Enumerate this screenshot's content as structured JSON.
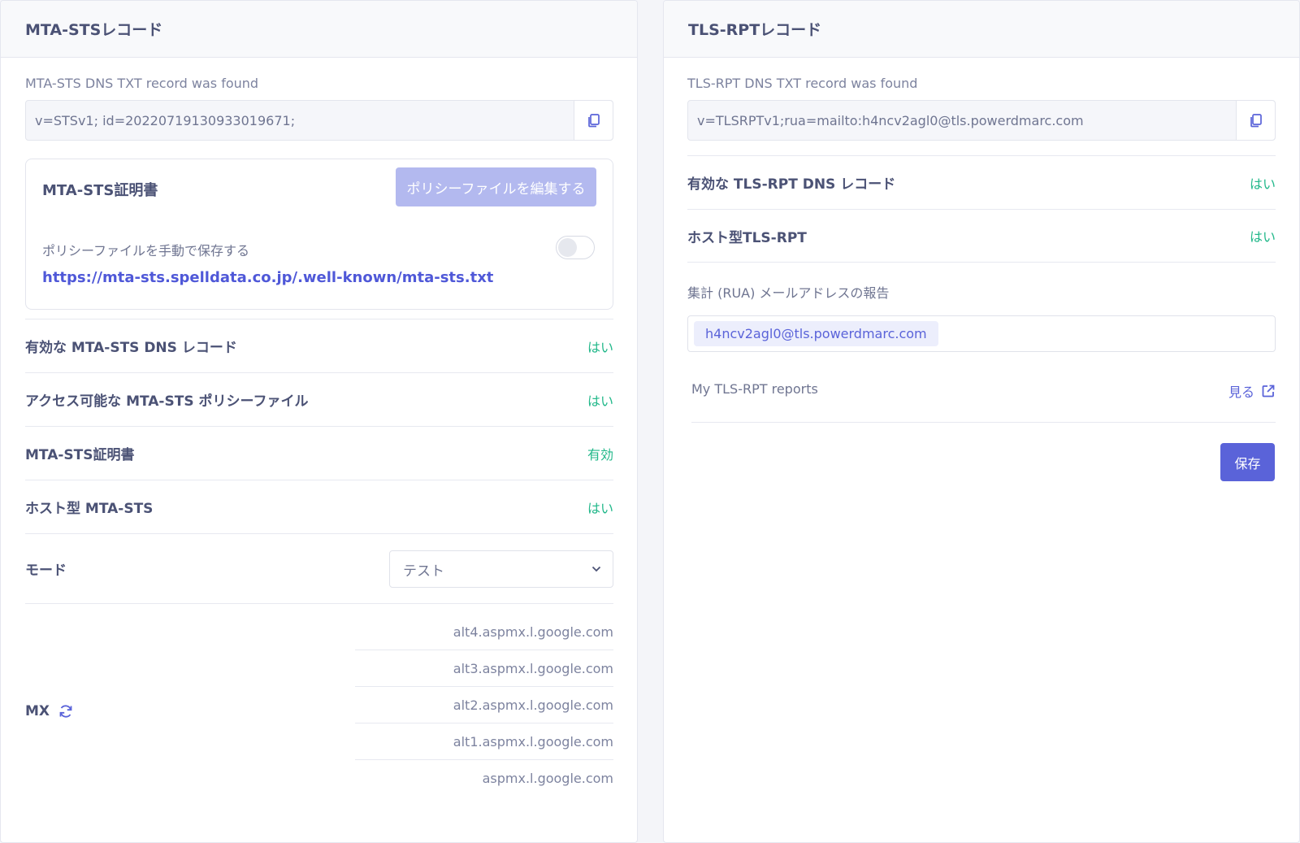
{
  "mta_sts": {
    "title": "MTA-STSレコード",
    "found_label": "MTA-STS DNS TXT record was found",
    "record_value": "v=STSv1; id=20220719130933019671;",
    "certificate": {
      "title": "MTA-STS証明書",
      "edit_button": "ポリシーファイルを編集する",
      "manual_save_label": "ポリシーファイルを手動で保存する",
      "manual_save_enabled": false,
      "policy_url": "https://mta-sts.spelldata.co.jp/.well-known/mta-sts.txt"
    },
    "checks": [
      {
        "name": "有効な MTA-STS DNS レコード",
        "status": "はい"
      },
      {
        "name": "アクセス可能な MTA-STS ポリシーファイル",
        "status": "はい"
      },
      {
        "name": "MTA-STS証明書",
        "status": "有効"
      },
      {
        "name": "ホスト型 MTA-STS",
        "status": "はい"
      }
    ],
    "mode": {
      "label": "モード",
      "selected": "テスト"
    },
    "mx": {
      "label": "MX",
      "records": [
        "alt4.aspmx.l.google.com",
        "alt3.aspmx.l.google.com",
        "alt2.aspmx.l.google.com",
        "alt1.aspmx.l.google.com",
        "aspmx.l.google.com"
      ]
    }
  },
  "tls_rpt": {
    "title": "TLS-RPTレコード",
    "found_label": "TLS-RPT DNS TXT record was found",
    "record_value": "v=TLSRPTv1;rua=mailto:h4ncv2agl0@tls.powerdmarc.com",
    "checks": [
      {
        "name": "有効な TLS-RPT DNS レコード",
        "status": "はい"
      },
      {
        "name": "ホスト型TLS-RPT",
        "status": "はい"
      }
    ],
    "rua_label": "集計 (RUA) メールアドレスの報告",
    "rua_emails": [
      "h4ncv2agl0@tls.powerdmarc.com"
    ],
    "reports_label": "My TLS-RPT reports",
    "view_label": "見る",
    "save_button": "保存"
  },
  "colors": {
    "accent": "#5a63d9",
    "success": "#22b88a",
    "disabled_button": "#b3b9ef"
  }
}
